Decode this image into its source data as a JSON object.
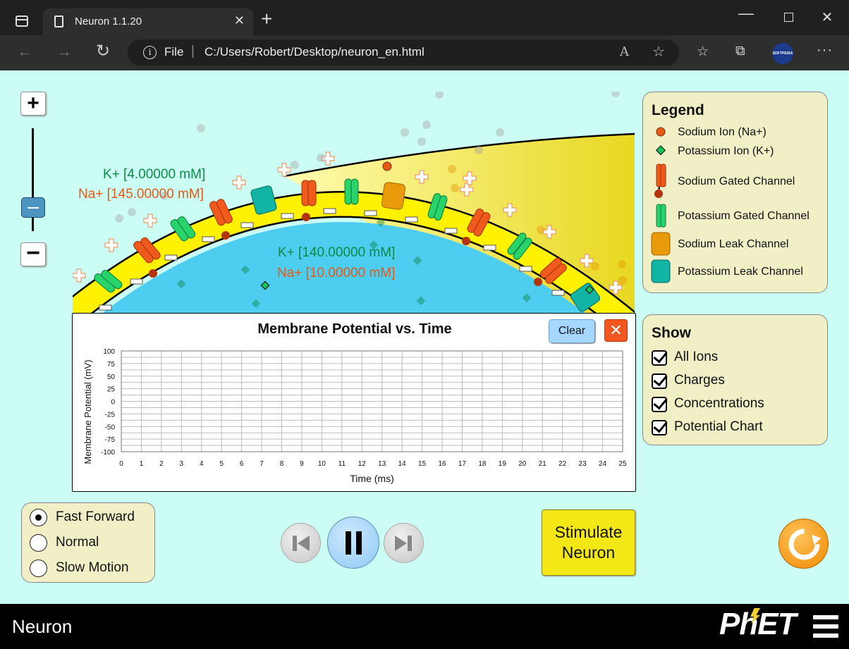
{
  "browser": {
    "tab_title": "Neuron 1.1.20",
    "address_scheme": "File",
    "address_url": "C:/Users/Robert/Desktop/neuron_en.html",
    "profile_label": "SOFTPEDIA"
  },
  "scene": {
    "outside_k": "K+ [4.00000 mM]",
    "outside_na": "Na+ [145.00000 mM]",
    "inside_k": "K+ [140.00000 mM]",
    "inside_na": "Na+ [10.00000 mM]",
    "colors": {
      "background": "#ccfdf5",
      "membrane": "#fff200",
      "cytoplasm": "#4dcdf0",
      "sodium": "#e45a17",
      "potassium": "#0b8a46"
    }
  },
  "chart": {
    "clear_label": "Clear",
    "close_label": "✕"
  },
  "chart_data": {
    "type": "line",
    "title": "Membrane Potential vs. Time",
    "xlabel": "Time (ms)",
    "ylabel": "Membrane Potential (mV)",
    "xlim": [
      0,
      25
    ],
    "ylim": [
      -100,
      100
    ],
    "xticks": [
      0,
      1,
      2,
      3,
      4,
      5,
      6,
      7,
      8,
      9,
      10,
      11,
      12,
      13,
      14,
      15,
      16,
      17,
      18,
      19,
      20,
      21,
      22,
      23,
      24,
      25
    ],
    "yticks": [
      100,
      75,
      50,
      25,
      0,
      -25,
      -50,
      -75,
      -100
    ],
    "grid": true,
    "series": []
  },
  "legend": {
    "title": "Legend",
    "items": [
      {
        "label": "Sodium Ion (Na+)",
        "icon": "sodium-ion-icon"
      },
      {
        "label": "Potassium Ion (K+)",
        "icon": "potassium-ion-icon"
      },
      {
        "label": "Sodium Gated Channel",
        "icon": "sodium-gated-channel-icon"
      },
      {
        "label": "Potassium Gated Channel",
        "icon": "potassium-gated-channel-icon"
      },
      {
        "label": "Sodium Leak Channel",
        "icon": "sodium-leak-channel-icon"
      },
      {
        "label": "Potassium Leak Channel",
        "icon": "potassium-leak-channel-icon"
      }
    ]
  },
  "show": {
    "title": "Show",
    "items": [
      {
        "label": "All Ions",
        "checked": true
      },
      {
        "label": "Charges",
        "checked": true
      },
      {
        "label": "Concentrations",
        "checked": true
      },
      {
        "label": "Potential Chart",
        "checked": true
      }
    ]
  },
  "speed": {
    "options": [
      {
        "label": "Fast Forward",
        "selected": true
      },
      {
        "label": "Normal",
        "selected": false
      },
      {
        "label": "Slow Motion",
        "selected": false
      }
    ]
  },
  "controls": {
    "stimulate_line1": "Stimulate",
    "stimulate_line2": "Neuron"
  },
  "navbar": {
    "sim_title": "Neuron",
    "logo_text": "PhET"
  }
}
